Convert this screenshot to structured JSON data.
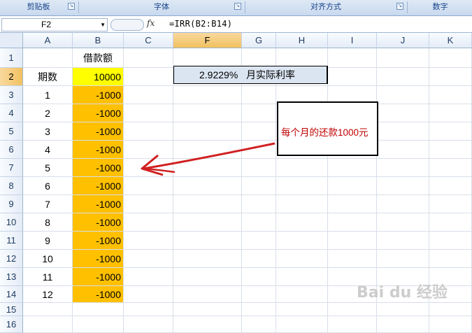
{
  "ribbon": {
    "groups": [
      {
        "label": "剪贴板"
      },
      {
        "label": "字体"
      },
      {
        "label": "对齐方式"
      },
      {
        "label": "数字"
      }
    ]
  },
  "formula_bar": {
    "name_box": "F2",
    "fx_label": "fx",
    "formula": "=IRR(B2:B14)"
  },
  "columns": [
    "A",
    "B",
    "C",
    "F",
    "G",
    "H",
    "I",
    "J",
    "K"
  ],
  "rows": [
    "1",
    "2",
    "3",
    "4",
    "5",
    "6",
    "7",
    "8",
    "9",
    "10",
    "11",
    "12",
    "13",
    "14",
    "15",
    "16"
  ],
  "cells": {
    "b1": "借款额",
    "a2": "期数",
    "b2": "10000",
    "periods": [
      "1",
      "2",
      "3",
      "4",
      "5",
      "6",
      "7",
      "8",
      "9",
      "10",
      "11",
      "12"
    ],
    "payments": [
      "-1000",
      "-1000",
      "-1000",
      "-1000",
      "-1000",
      "-1000",
      "-1000",
      "-1000",
      "-1000",
      "-1000",
      "-1000",
      "-1000"
    ]
  },
  "irr_result": {
    "value": "2.9229%",
    "label": "月实际利率"
  },
  "annotation": {
    "text": "每个月的还款1000元",
    "color": "#c00000"
  },
  "colors": {
    "b2_fill": "#ffff00",
    "payments_fill": "#ffc000",
    "result_fill": "#dbe5f1",
    "arrow": "#d02020"
  },
  "watermark": "Bai du 经验"
}
